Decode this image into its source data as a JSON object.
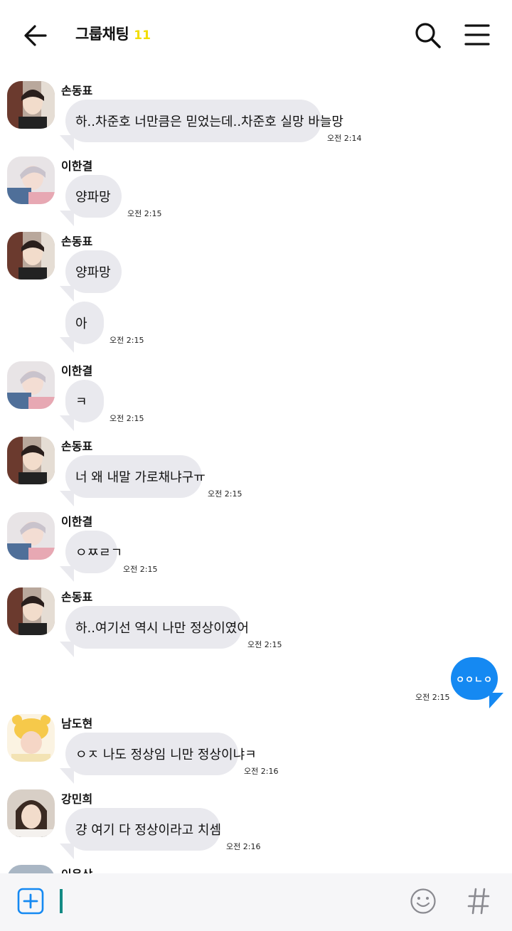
{
  "header": {
    "title": "그룹채팅",
    "member_count": "11"
  },
  "colors": {
    "bubble_other": "#e9e9ee",
    "bubble_mine": "#1589f2",
    "count": "#f2dd00"
  },
  "messages": [
    {
      "sender": "손동표",
      "text": "하..차준호 너만큼은 믿었는데..차준호 실망 바늘망",
      "time": "오전 2:14"
    },
    {
      "sender": "이한결",
      "text": "양파망",
      "time": "오전 2:15"
    },
    {
      "sender": "손동표",
      "text": "양파망",
      "time": ""
    },
    {
      "sender": "",
      "text": "아",
      "time": "오전 2:15"
    },
    {
      "sender": "이한결",
      "text": "ㅋ",
      "time": "오전 2:15"
    },
    {
      "sender": "손동표",
      "text": "너 왜 내말 가로채냐구ㅠ",
      "time": "오전 2:15"
    },
    {
      "sender": "이한결",
      "text": "ㅇㅉㄹㄱ",
      "time": "오전 2:15"
    },
    {
      "sender": "손동표",
      "text": "하..여기선 역시 나만 정상이였어",
      "time": "오전 2:15"
    },
    {
      "sender": "me",
      "text": "ㅇㅇㄴㅇ",
      "time": "오전 2:15"
    },
    {
      "sender": "남도현",
      "text": "ㅇㅈ 나도 정상임 니만 정상이냐ㅋ",
      "time": "오전 2:16"
    },
    {
      "sender": "강민희",
      "text": "걍 여기 다 정상이라고 치셈",
      "time": "오전 2:16"
    },
    {
      "sender": "이은상",
      "text": "",
      "time": ""
    }
  ],
  "icons": {
    "back": "arrow-left-icon",
    "search": "search-icon",
    "menu": "hamburger-menu-icon",
    "attach": "plus-box-icon",
    "emoji": "smiley-icon",
    "hashtag": "hashtag-icon"
  }
}
